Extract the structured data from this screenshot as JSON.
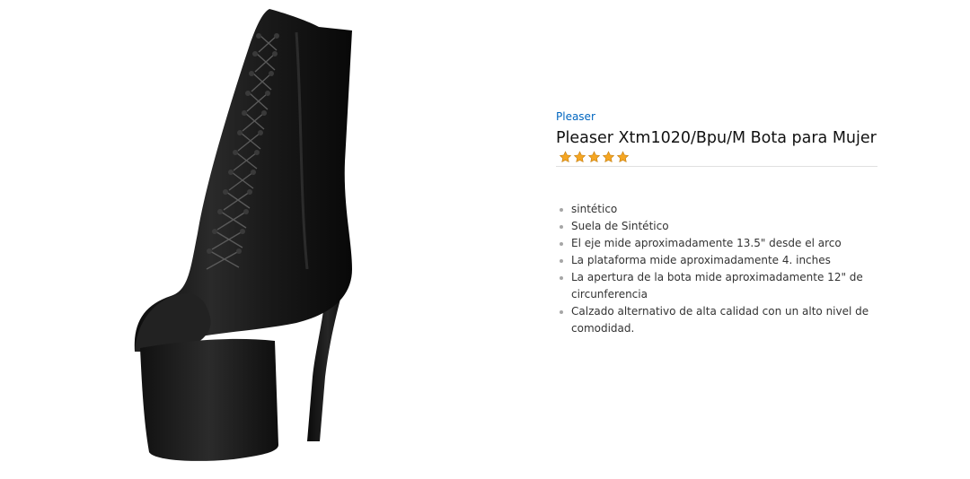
{
  "product": {
    "brand": "Pleaser",
    "title": "Pleaser Xtm1020/Bpu/M Bota para Mujer",
    "rating_stars": 5,
    "star_color": "#f5a623",
    "image_icon": "black-platform-ankle-boot-image",
    "features": [
      "sintético",
      "Suela de Sintético",
      "El eje mide aproximadamente 13.5\" desde el arco",
      "La plataforma mide aproximadamente 4. inches",
      "La apertura de la bota mide aproximadamente 12\" de circunferencia",
      "Calzado alternativo de alta calidad con un alto nivel de comodidad."
    ]
  }
}
